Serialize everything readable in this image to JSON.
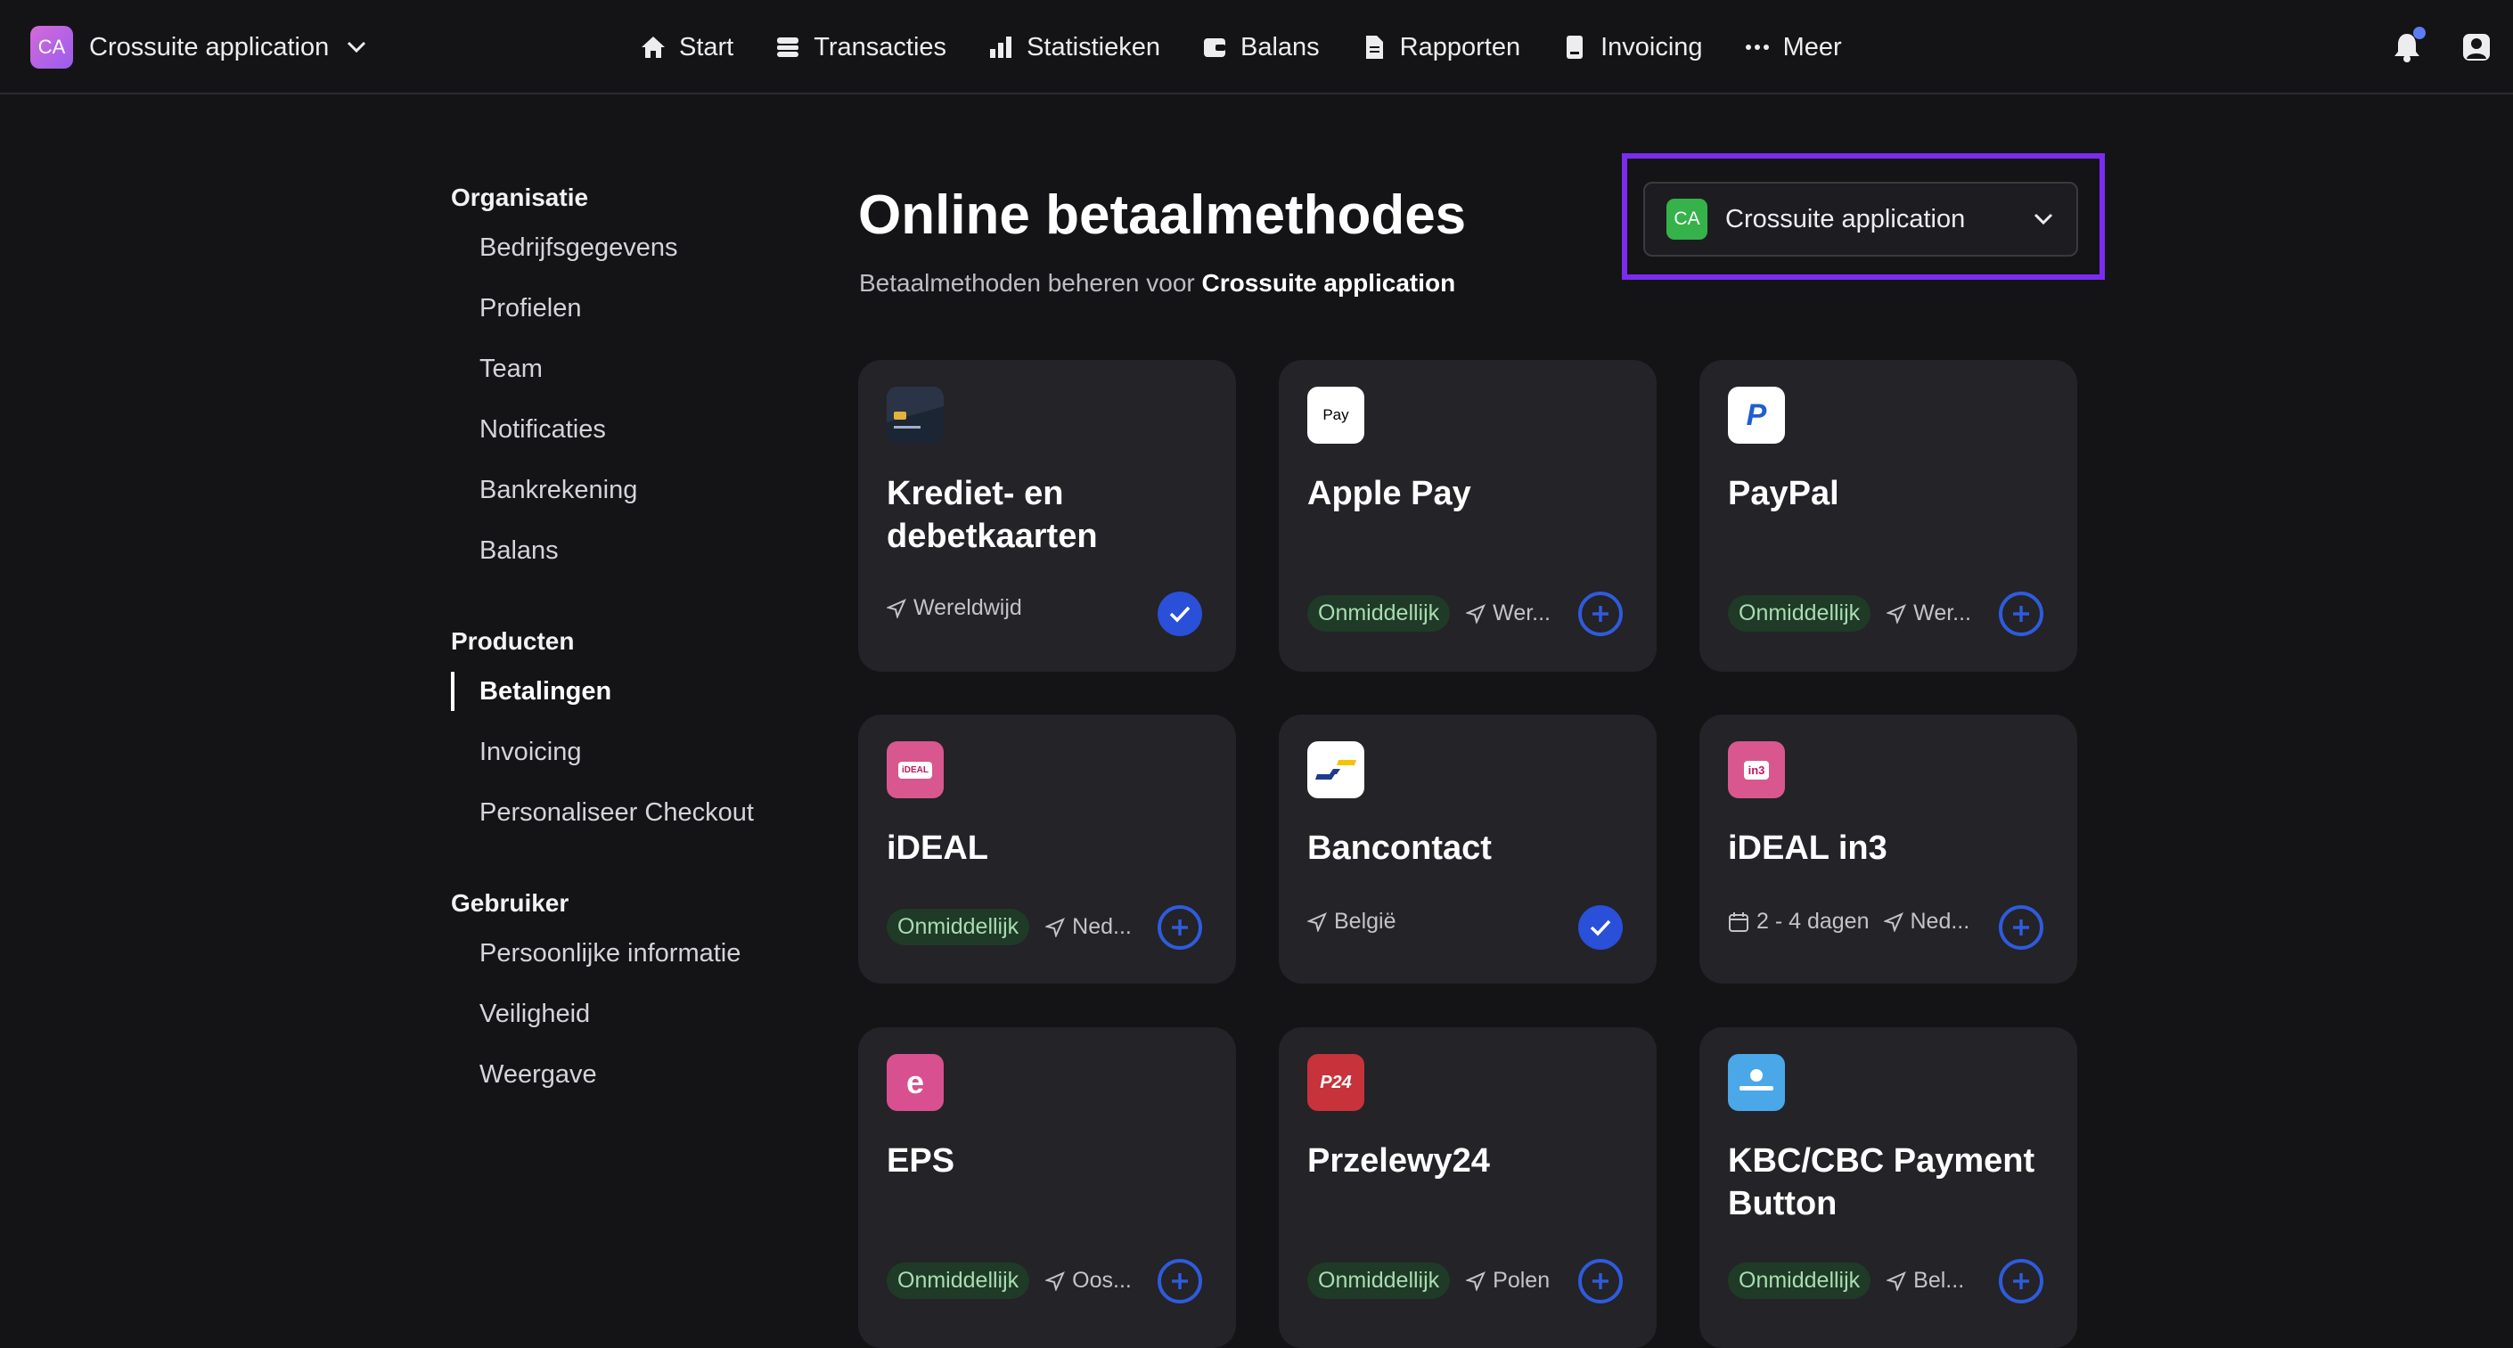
{
  "header": {
    "org_initials": "CA",
    "org_name": "Crossuite application",
    "nav": [
      {
        "label": "Start",
        "icon": "home-icon"
      },
      {
        "label": "Transacties",
        "icon": "stack-icon"
      },
      {
        "label": "Statistieken",
        "icon": "bar-chart-icon"
      },
      {
        "label": "Balans",
        "icon": "wallet-icon"
      },
      {
        "label": "Rapporten",
        "icon": "document-icon"
      },
      {
        "label": "Invoicing",
        "icon": "invoice-icon"
      },
      {
        "label": "Meer",
        "icon": "more-icon"
      }
    ]
  },
  "sidebar": {
    "sections": [
      {
        "title": "Organisatie",
        "items": [
          "Bedrijfsgegevens",
          "Profielen",
          "Team",
          "Notificaties",
          "Bankrekening",
          "Balans"
        ]
      },
      {
        "title": "Producten",
        "items": [
          "Betalingen",
          "Invoicing",
          "Personaliseer Checkout"
        ],
        "active": "Betalingen"
      },
      {
        "title": "Gebruiker",
        "items": [
          "Persoonlijke informatie",
          "Veiligheid",
          "Weergave"
        ]
      }
    ]
  },
  "main": {
    "title": "Online betaalmethodes",
    "subtitle_prefix": "Betaalmethoden beheren voor",
    "subtitle_org": "Crossuite application",
    "org_select": {
      "initials": "CA",
      "name": "Crossuite application"
    }
  },
  "methods": [
    {
      "name": "Krediet- en debetkaarten",
      "badge": "",
      "duration": "",
      "region": "Wereldwijd",
      "enabled": true,
      "logo": "card-logo"
    },
    {
      "name": "Apple Pay",
      "badge": "Onmiddellijk",
      "duration": "",
      "region": "Wer...",
      "enabled": false,
      "logo": "apple-pay-logo",
      "logo_text": "Pay"
    },
    {
      "name": "PayPal",
      "badge": "Onmiddellijk",
      "duration": "",
      "region": "Wer...",
      "enabled": false,
      "logo": "paypal-logo",
      "logo_text": "P"
    },
    {
      "name": "iDEAL",
      "badge": "Onmiddellijk",
      "duration": "",
      "region": "Ned...",
      "enabled": false,
      "logo": "ideal-logo",
      "logo_text": "iDEAL"
    },
    {
      "name": "Bancontact",
      "badge": "",
      "duration": "",
      "region": "België",
      "enabled": true,
      "logo": "bancontact-logo"
    },
    {
      "name": "iDEAL in3",
      "badge": "",
      "duration": "2 - 4 dagen",
      "region": "Ned...",
      "enabled": false,
      "logo": "ideal-in3-logo",
      "logo_text": "in3"
    },
    {
      "name": "EPS",
      "badge": "Onmiddellijk",
      "duration": "",
      "region": "Oos...",
      "enabled": false,
      "logo": "eps-logo",
      "logo_text": "e"
    },
    {
      "name": "Przelewy24",
      "badge": "Onmiddellijk",
      "duration": "",
      "region": "Polen",
      "enabled": false,
      "logo": "przelewy24-logo",
      "logo_text": "P24"
    },
    {
      "name": "KBC/CBC Payment Button",
      "badge": "Onmiddellijk",
      "duration": "",
      "region": "Bel...",
      "enabled": false,
      "logo": "kbc-logo"
    }
  ]
}
